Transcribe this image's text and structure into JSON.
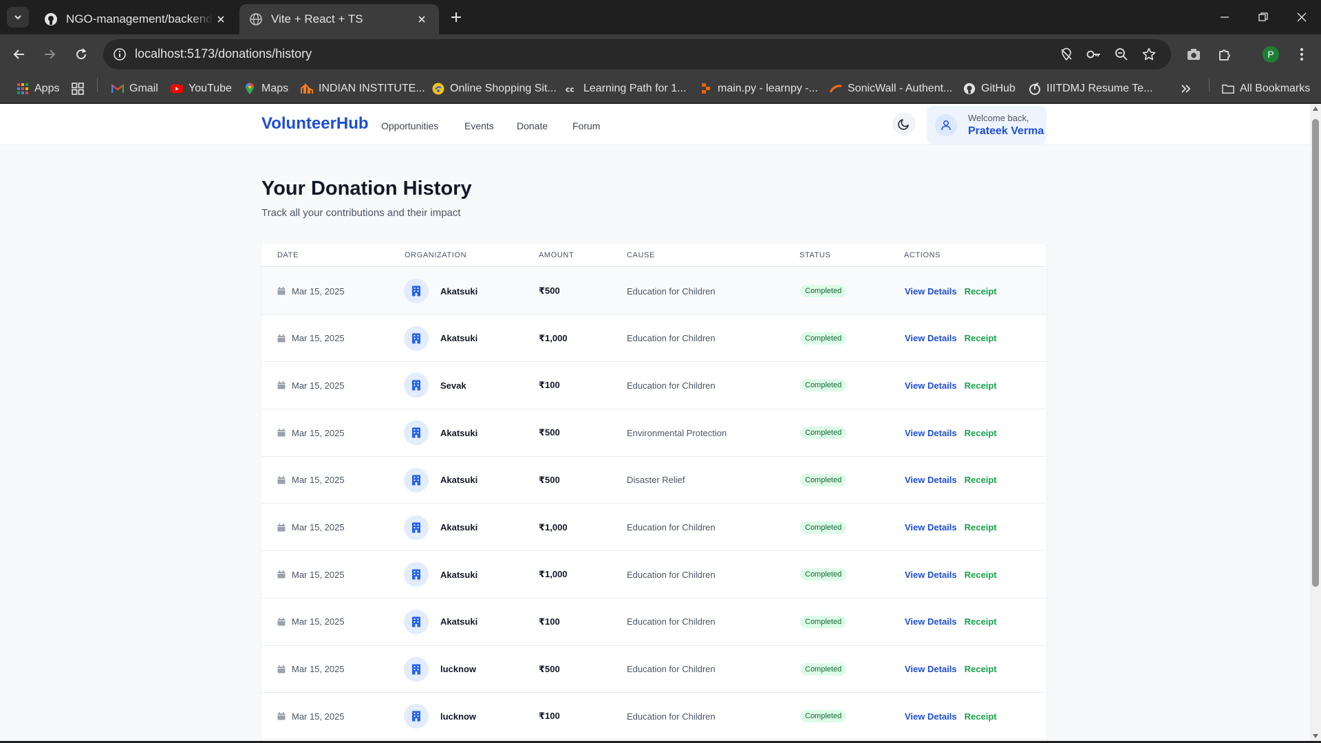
{
  "browser": {
    "tabs": [
      {
        "title": "NGO-management/backend at",
        "favicon": "github-icon",
        "active": false
      },
      {
        "title": "Vite + React + TS",
        "favicon": "globe-icon",
        "active": true
      }
    ],
    "url": "localhost:5173/donations/history",
    "profile_initial": "P",
    "bookmarks": [
      {
        "label": "Apps",
        "icon": "apps-grid-icon"
      },
      {
        "label": "",
        "icon": "tab-groups-icon"
      },
      {
        "label": "Gmail",
        "icon": "gmail-icon"
      },
      {
        "label": "YouTube",
        "icon": "youtube-icon"
      },
      {
        "label": "Maps",
        "icon": "maps-icon"
      },
      {
        "label": "INDIAN INSTITUTE...",
        "icon": "institute-icon"
      },
      {
        "label": "Online Shopping Sit...",
        "icon": "shopping-icon"
      },
      {
        "label": "Learning Path for 1...",
        "icon": "cc-icon"
      },
      {
        "label": "main.py - learnpy -...",
        "icon": "replit-icon"
      },
      {
        "label": "SonicWall - Authent...",
        "icon": "sonicwall-icon"
      },
      {
        "label": "GitHub",
        "icon": "github-icon"
      },
      {
        "label": "IIITDMJ Resume Te...",
        "icon": "overleaf-icon"
      }
    ],
    "all_bookmarks": "All Bookmarks"
  },
  "app": {
    "brand": "VolunteerHub",
    "nav": [
      "Opportunities",
      "Events",
      "Donate",
      "Forum"
    ],
    "user": {
      "welcome": "Welcome back,",
      "name": "Prateek Verma"
    },
    "accent_color": "#1d4ed8"
  },
  "page": {
    "title": "Your Donation History",
    "subtitle": "Track all your contributions and their impact"
  },
  "table": {
    "headers": [
      "DATE",
      "ORGANIZATION",
      "AMOUNT",
      "CAUSE",
      "STATUS",
      "ACTIONS"
    ],
    "actions": {
      "details": "View Details",
      "receipt": "Receipt"
    },
    "rows": [
      {
        "date": "Mar 15, 2025",
        "org": "Akatsuki",
        "amount": "₹500",
        "cause": "Education for Children",
        "status": "Completed"
      },
      {
        "date": "Mar 15, 2025",
        "org": "Akatsuki",
        "amount": "₹1,000",
        "cause": "Education for Children",
        "status": "Completed"
      },
      {
        "date": "Mar 15, 2025",
        "org": "Sevak",
        "amount": "₹100",
        "cause": "Education for Children",
        "status": "Completed"
      },
      {
        "date": "Mar 15, 2025",
        "org": "Akatsuki",
        "amount": "₹500",
        "cause": "Environmental Protection",
        "status": "Completed"
      },
      {
        "date": "Mar 15, 2025",
        "org": "Akatsuki",
        "amount": "₹500",
        "cause": "Disaster Relief",
        "status": "Completed"
      },
      {
        "date": "Mar 15, 2025",
        "org": "Akatsuki",
        "amount": "₹1,000",
        "cause": "Education for Children",
        "status": "Completed"
      },
      {
        "date": "Mar 15, 2025",
        "org": "Akatsuki",
        "amount": "₹1,000",
        "cause": "Education for Children",
        "status": "Completed"
      },
      {
        "date": "Mar 15, 2025",
        "org": "Akatsuki",
        "amount": "₹100",
        "cause": "Education for Children",
        "status": "Completed"
      },
      {
        "date": "Mar 15, 2025",
        "org": "lucknow",
        "amount": "₹500",
        "cause": "Education for Children",
        "status": "Completed"
      },
      {
        "date": "Mar 15, 2025",
        "org": "lucknow",
        "amount": "₹100",
        "cause": "Education for Children",
        "status": "Completed"
      }
    ]
  }
}
